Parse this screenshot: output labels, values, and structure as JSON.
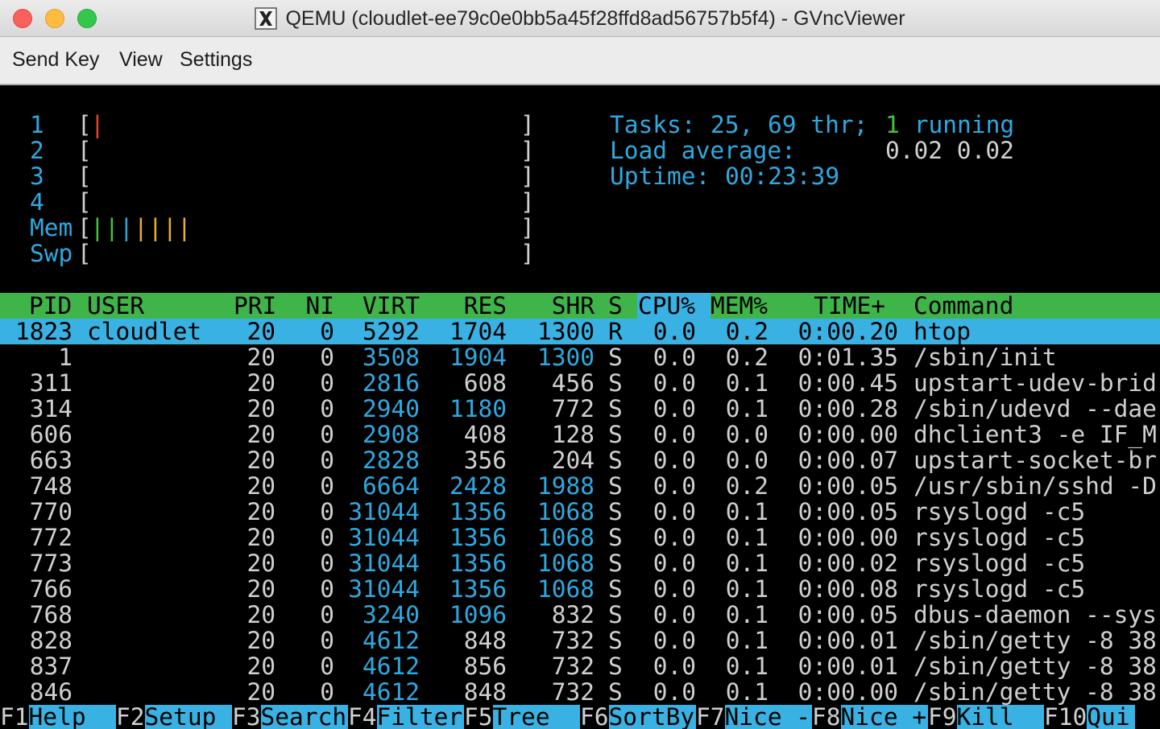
{
  "window": {
    "title": "QEMU (cloudlet-ee79c0e0bb5a45f28ffd8ad56757b5f4) - GVncViewer",
    "app_icon": "x11-icon"
  },
  "menubar": {
    "items": [
      "Send Key",
      "View",
      "Settings"
    ]
  },
  "meters": {
    "cpu": [
      {
        "label": "1",
        "bar": "|",
        "bar_color": "#e0442c"
      },
      {
        "label": "2",
        "bar": ""
      },
      {
        "label": "3",
        "bar": ""
      },
      {
        "label": "4",
        "bar": ""
      }
    ],
    "mem": {
      "label": "Mem",
      "bars": [
        {
          "ch": "|",
          "color": "#46c23c"
        },
        {
          "ch": "|",
          "color": "#46c23c"
        },
        {
          "ch": "|",
          "color": "#2ea9e0"
        },
        {
          "ch": "|",
          "color": "#e3b22d"
        },
        {
          "ch": "|",
          "color": "#e3b22d"
        },
        {
          "ch": "|",
          "color": "#e3b22d"
        },
        {
          "ch": "|",
          "color": "#e3b22d"
        }
      ]
    },
    "swp": {
      "label": "Swp"
    },
    "open_bracket": "[",
    "close_bracket": "]"
  },
  "summary": {
    "tasks_label": "Tasks: ",
    "tasks_value": "25, 69 thr; ",
    "running_value": "1",
    "running_label": " running",
    "load_label": "Load average:",
    "load_values": "0.02 0.02",
    "uptime_label": "Uptime: ",
    "uptime_value": "00:23:39"
  },
  "columns": [
    "PID",
    "USER",
    "PRI",
    "NI",
    "VIRT",
    "RES",
    "SHR",
    "S",
    "CPU%",
    "MEM%",
    "TIME+",
    "Command"
  ],
  "processes": [
    {
      "pid": "1823",
      "user": "cloudlet",
      "pri": "20",
      "ni": "0",
      "virt": "5292",
      "res": "1704",
      "shr": "1300",
      "s": "R",
      "cpu": "0.0",
      "mem": "0.2",
      "time": "0:00.20",
      "cmd": "htop",
      "selected": true
    },
    {
      "pid": "1",
      "user": "",
      "pri": "20",
      "ni": "0",
      "virt": "3508",
      "res": "1904",
      "shr": "1300",
      "s": "S",
      "cpu": "0.0",
      "mem": "0.2",
      "time": "0:01.35",
      "cmd": "/sbin/init"
    },
    {
      "pid": "311",
      "user": "",
      "pri": "20",
      "ni": "0",
      "virt": "2816",
      "res": "608",
      "shr": "456",
      "s": "S",
      "cpu": "0.0",
      "mem": "0.1",
      "time": "0:00.45",
      "cmd": "upstart-udev-brid"
    },
    {
      "pid": "314",
      "user": "",
      "pri": "20",
      "ni": "0",
      "virt": "2940",
      "res": "1180",
      "shr": "772",
      "s": "S",
      "cpu": "0.0",
      "mem": "0.1",
      "time": "0:00.28",
      "cmd": "/sbin/udevd --dae"
    },
    {
      "pid": "606",
      "user": "",
      "pri": "20",
      "ni": "0",
      "virt": "2908",
      "res": "408",
      "shr": "128",
      "s": "S",
      "cpu": "0.0",
      "mem": "0.0",
      "time": "0:00.00",
      "cmd": "dhclient3 -e IF_M"
    },
    {
      "pid": "663",
      "user": "",
      "pri": "20",
      "ni": "0",
      "virt": "2828",
      "res": "356",
      "shr": "204",
      "s": "S",
      "cpu": "0.0",
      "mem": "0.0",
      "time": "0:00.07",
      "cmd": "upstart-socket-br"
    },
    {
      "pid": "748",
      "user": "",
      "pri": "20",
      "ni": "0",
      "virt": "6664",
      "res": "2428",
      "shr": "1988",
      "s": "S",
      "cpu": "0.0",
      "mem": "0.2",
      "time": "0:00.05",
      "cmd": "/usr/sbin/sshd -D"
    },
    {
      "pid": "770",
      "user": "",
      "pri": "20",
      "ni": "0",
      "virt": "31044",
      "res": "1356",
      "shr": "1068",
      "s": "S",
      "cpu": "0.0",
      "mem": "0.1",
      "time": "0:00.05",
      "cmd": "rsyslogd -c5"
    },
    {
      "pid": "772",
      "user": "",
      "pri": "20",
      "ni": "0",
      "virt": "31044",
      "res": "1356",
      "shr": "1068",
      "s": "S",
      "cpu": "0.0",
      "mem": "0.1",
      "time": "0:00.00",
      "cmd": "rsyslogd -c5"
    },
    {
      "pid": "773",
      "user": "",
      "pri": "20",
      "ni": "0",
      "virt": "31044",
      "res": "1356",
      "shr": "1068",
      "s": "S",
      "cpu": "0.0",
      "mem": "0.1",
      "time": "0:00.02",
      "cmd": "rsyslogd -c5"
    },
    {
      "pid": "766",
      "user": "",
      "pri": "20",
      "ni": "0",
      "virt": "31044",
      "res": "1356",
      "shr": "1068",
      "s": "S",
      "cpu": "0.0",
      "mem": "0.1",
      "time": "0:00.08",
      "cmd": "rsyslogd -c5"
    },
    {
      "pid": "768",
      "user": "",
      "pri": "20",
      "ni": "0",
      "virt": "3240",
      "res": "1096",
      "shr": "832",
      "s": "S",
      "cpu": "0.0",
      "mem": "0.1",
      "time": "0:00.05",
      "cmd": "dbus-daemon --sys"
    },
    {
      "pid": "828",
      "user": "",
      "pri": "20",
      "ni": "0",
      "virt": "4612",
      "res": "848",
      "shr": "732",
      "s": "S",
      "cpu": "0.0",
      "mem": "0.1",
      "time": "0:00.01",
      "cmd": "/sbin/getty -8 38"
    },
    {
      "pid": "837",
      "user": "",
      "pri": "20",
      "ni": "0",
      "virt": "4612",
      "res": "856",
      "shr": "732",
      "s": "S",
      "cpu": "0.0",
      "mem": "0.1",
      "time": "0:00.01",
      "cmd": "/sbin/getty -8 38"
    },
    {
      "pid": "846",
      "user": "",
      "pri": "20",
      "ni": "0",
      "virt": "4612",
      "res": "848",
      "shr": "732",
      "s": "S",
      "cpu": "0.0",
      "mem": "0.1",
      "time": "0:00.00",
      "cmd": "/sbin/getty -8 38"
    }
  ],
  "function_keys": [
    {
      "key": "F1",
      "label": "Help  "
    },
    {
      "key": "F2",
      "label": "Setup "
    },
    {
      "key": "F3",
      "label": "Search"
    },
    {
      "key": "F4",
      "label": "Filter"
    },
    {
      "key": "F5",
      "label": "Tree  "
    },
    {
      "key": "F6",
      "label": "SortBy"
    },
    {
      "key": "F7",
      "label": "Nice -"
    },
    {
      "key": "F8",
      "label": "Nice +"
    },
    {
      "key": "F9",
      "label": "Kill  "
    },
    {
      "key": "F10",
      "label": "Qui"
    }
  ],
  "colors": {
    "header_bg": "#3fb549",
    "selected_bg": "#39b2e3",
    "cyan_text": "#2ea9e0",
    "green_text": "#46c23c",
    "default_text": "#d0d0d0"
  }
}
